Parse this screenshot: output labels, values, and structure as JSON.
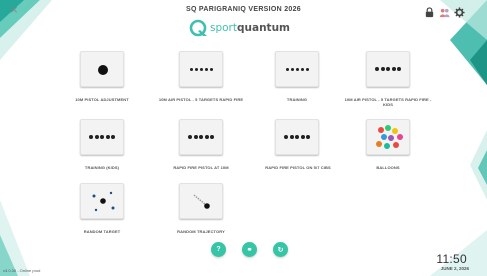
{
  "header": {
    "title": "SQ PARIGRANIQ VERSION 2026",
    "logo": {
      "text_light": "sport",
      "text_bold": "quantum"
    },
    "close_icon": "×",
    "icons": [
      "lock-icon",
      "people-icon",
      "gear-icon"
    ]
  },
  "tiles": [
    {
      "label": "10M PISTOL ADJUSTMENT",
      "pictogram": "single-dot"
    },
    {
      "label": "10M AIR PISTOL - 5 TARGETS RAPID FIRE",
      "pictogram": "five-dots-small"
    },
    {
      "label": "TRAINING",
      "pictogram": "five-dots-small"
    },
    {
      "label": "10M AIR PISTOL - 5 TARGETS RAPID FIRE - KIDS",
      "pictogram": "five-dots-large"
    },
    {
      "label": "TRAINING (KIDS)",
      "pictogram": "five-dots-large"
    },
    {
      "label": "RAPID FIRE PISTOL AT 10M",
      "pictogram": "five-dots-large"
    },
    {
      "label": "RAPID FIRE PISTOL ON 5/7 CIBS",
      "pictogram": "five-dots-large"
    },
    {
      "label": "BALLOONS",
      "pictogram": "balloons"
    },
    {
      "label": "RANDOM TARGET",
      "pictogram": "scattered-dots"
    },
    {
      "label": "RANDOM TRAJECTORY",
      "pictogram": "trajectory"
    }
  ],
  "bottom_buttons": [
    {
      "icon": "help-icon",
      "glyph": "?"
    },
    {
      "icon": "link-icon",
      "glyph": "⚭"
    },
    {
      "icon": "refresh-icon",
      "glyph": "↻"
    }
  ],
  "footer": {
    "version": "v3.0.30 - Online prod",
    "time": "11:50",
    "date": "JUNE 2, 2026"
  },
  "colors": {
    "accent": "#36c5a7",
    "logo_teal": "#3fbfb0",
    "background_teal_dark": "#1fa596",
    "background_teal_light": "#bfe8e1"
  }
}
